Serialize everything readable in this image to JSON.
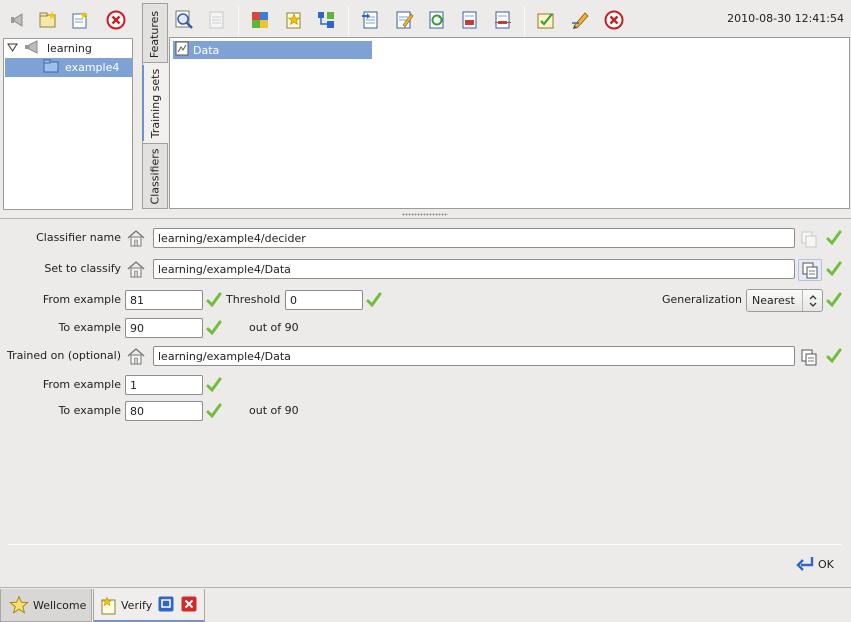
{
  "tree_toolbar": {
    "icons": [
      "back-icon",
      "new-folder-icon",
      "add-item-icon",
      "close-red-icon"
    ]
  },
  "tree": {
    "root_label": "learning",
    "child_label": "example4"
  },
  "vertical_tabs": {
    "features": "Features",
    "training_sets": "Training sets",
    "classifiers": "Classifiers"
  },
  "main_toolbar": {
    "icons": [
      "zoom-icon",
      "disabled-doc-icon",
      "puzzle-icon",
      "star-doc-icon",
      "tree-add-icon",
      "import-doc-icon",
      "edit-doc-icon",
      "refresh-doc-icon",
      "export-doc-icon",
      "cut-doc-icon",
      "checklist-icon",
      "pencil-icon",
      "stop-icon"
    ],
    "timestamp": "2010-08-30 12:41:54"
  },
  "data_list": {
    "items": [
      {
        "label": "Data"
      }
    ]
  },
  "form": {
    "classifier_name": {
      "label": "Classifier name",
      "value": "learning/example4/decider"
    },
    "set_to_classify": {
      "label": "Set to classify",
      "value": "learning/example4/Data"
    },
    "from_example_1": {
      "label": "From example",
      "value": "81"
    },
    "threshold": {
      "label": "Threshold",
      "value": "0"
    },
    "generalization": {
      "label": "Generalization",
      "value": "Nearest"
    },
    "to_example_1": {
      "label": "To example",
      "value": "90",
      "suffix": "out of 90"
    },
    "trained_on": {
      "label": "Trained on (optional)",
      "value": "learning/example4/Data"
    },
    "from_example_2": {
      "label": "From example",
      "value": "1"
    },
    "to_example_2": {
      "label": "To example",
      "value": "80",
      "suffix": "out of 90"
    },
    "ok_label": "OK"
  },
  "bottom_tabs": {
    "wellcome": "Wellcome",
    "verify": "Verify"
  },
  "colors": {
    "selection": "#7fa2d6",
    "check_green": "#6fbf3a",
    "close_red": "#d02a2a",
    "accent_blue": "#2f67c9"
  }
}
